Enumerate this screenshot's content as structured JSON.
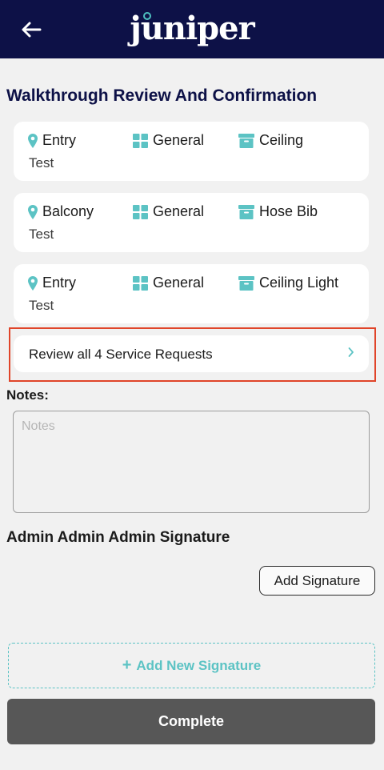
{
  "header": {
    "logo_text": "juniper",
    "colors": {
      "background": "#0d1147",
      "accent": "#4ec0c0"
    }
  },
  "page": {
    "title": "Walkthrough Review And Confirmation"
  },
  "service_requests": [
    {
      "location": "Entry",
      "category": "General",
      "item": "Ceiling",
      "description": "Test"
    },
    {
      "location": "Balcony",
      "category": "General",
      "item": "Hose Bib",
      "description": "Test"
    },
    {
      "location": "Entry",
      "category": "General",
      "item": "Ceiling Light",
      "description": "Test"
    }
  ],
  "icons": {
    "location": "map-pin-icon",
    "category": "grid-icon",
    "item": "archive-box-icon",
    "back": "arrow-left-icon",
    "chevron": "chevron-right-icon"
  },
  "review": {
    "label": "Review all 4 Service Requests",
    "highlight_color": "#e0452a"
  },
  "notes": {
    "label": "Notes:",
    "placeholder": "Notes",
    "value": ""
  },
  "signature": {
    "label": "Admin Admin Admin Signature",
    "add_button": "Add Signature",
    "add_new_label": "Add New Signature",
    "add_new_plus": "+"
  },
  "actions": {
    "complete_label": "Complete",
    "complete_color": "#575757"
  }
}
